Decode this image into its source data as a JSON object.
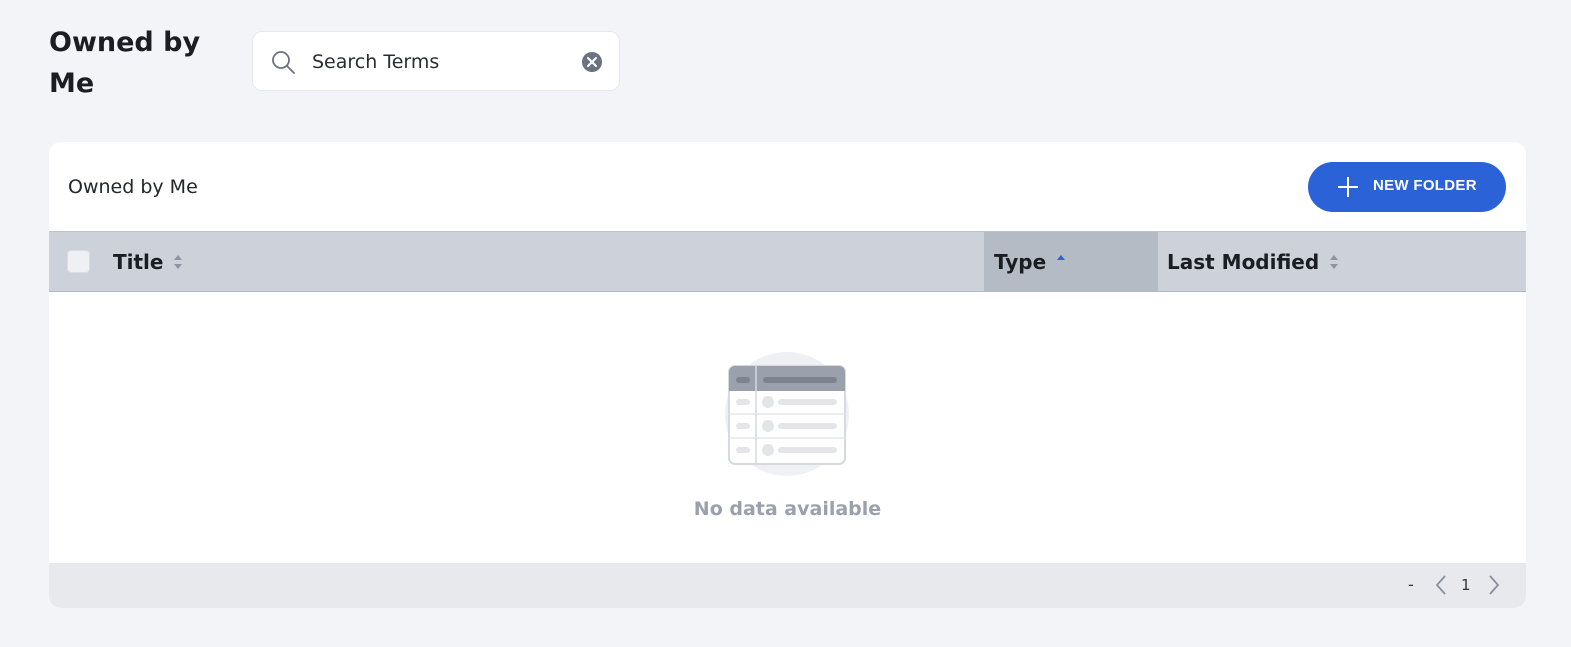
{
  "page": {
    "title": "Owned by Me"
  },
  "search": {
    "value": "Search Terms",
    "placeholder": "Search Terms"
  },
  "card": {
    "title": "Owned by Me",
    "new_folder_label": "NEW FOLDER"
  },
  "table": {
    "columns": [
      {
        "label": "Title",
        "sort": "none"
      },
      {
        "label": "Type",
        "sort": "ascending"
      },
      {
        "label": "Last Modified",
        "sort": "none"
      }
    ],
    "rows": [],
    "empty_text": "No data available"
  },
  "pagination": {
    "range": "-",
    "page": "1"
  },
  "colors": {
    "accent": "#2b62d7",
    "header_bg": "#cdd1d9",
    "active_header_bg": "#b5bbc4",
    "page_bg": "#f3f4f7"
  },
  "icons": [
    "search-icon",
    "clear-icon",
    "plus-icon",
    "sort-icon",
    "sort-asc-icon",
    "empty-table-icon",
    "chevron-left-icon",
    "chevron-right-icon"
  ]
}
